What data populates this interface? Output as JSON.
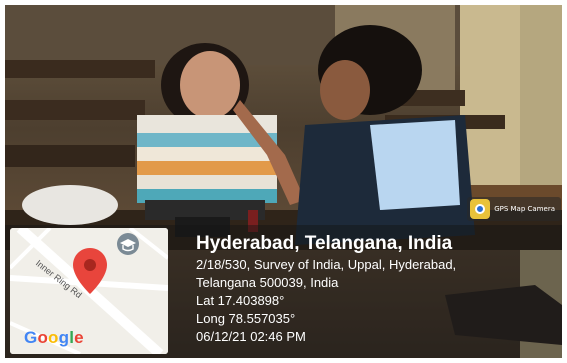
{
  "badge": {
    "label": "GPS Map Camera",
    "icon": "gps-map-camera-icon"
  },
  "map": {
    "road_label": "Inner Ring Rd",
    "logo": "Google",
    "logo_colors": [
      "#4285F4",
      "#EA4335",
      "#FBBC05",
      "#4285F4",
      "#34A853",
      "#EA4335"
    ],
    "pin_color": "#e8453c",
    "icons": [
      "map-pin-icon",
      "graduation-cap-icon"
    ]
  },
  "location": {
    "title": "Hyderabad, Telangana, India",
    "address_line1": "2/18/530, Survey of India, Uppal, Hyderabad,",
    "address_line2": "Telangana 500039, India",
    "lat": "Lat 17.403898°",
    "long": "Long 78.557035°",
    "datetime": "06/12/21 02:46 PM"
  }
}
